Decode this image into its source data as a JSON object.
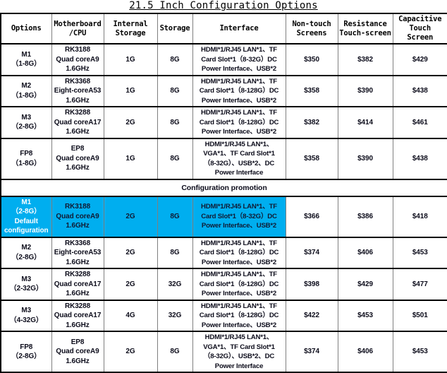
{
  "document": {
    "title": "21.5 Inch Configuration Options"
  },
  "table": {
    "headers": [
      "Options",
      "Motherboard /CPU",
      "Internal Storage",
      "Storage",
      "Interface",
      "Non-touch Screens",
      "Resistance Touch-screen",
      "Capacitive Touch Screen"
    ],
    "headers_lines": {
      "options": "Options",
      "motherboard_l1": "Motherboard",
      "motherboard_l2": "/CPU",
      "internal_l1": "Internal",
      "internal_l2": "Storage",
      "storage": "Storage",
      "interface": "Interface",
      "nontouch_l1": "Non-touch",
      "nontouch_l2": "Screens",
      "resistance_l1": "Resistance",
      "resistance_l2": "Touch-screen",
      "capacitive_l1": "Capacitive",
      "capacitive_l2": "Touch",
      "capacitive_l3": "Screen"
    },
    "promotion_label": "Configuration promotion",
    "colors": {
      "highlight_bg": "#00AEEF",
      "highlight_first_text": "#FFFFFF",
      "highlight_text": "#111A33",
      "border_outer": "#000000",
      "border_inner": "#7F7F7F",
      "page_bg": "#FFFFFF"
    },
    "rows": [
      {
        "option_name": "M1",
        "option_spec": "（1-8G）",
        "option_note": "",
        "cpu_l1": "RK3188",
        "cpu_l2": "Quad coreA9",
        "cpu_l3": "1.6GHz",
        "internal_storage": "1G",
        "storage": "8G",
        "interface_l1": "HDMI*1/RJ45 LAN*1、TF",
        "interface_l2": "Card Slot*1（8-32G）DC",
        "interface_l3": "Power Interface、USB*2",
        "interface_l4": "",
        "non_touch": "$350",
        "resistance": "$382",
        "capacitive": "$429",
        "highlight": false
      },
      {
        "option_name": "M2",
        "option_spec": "（1-8G）",
        "option_note": "",
        "cpu_l1": "RK3368",
        "cpu_l2": "Eight-coreA53",
        "cpu_l3": "1.6GHz",
        "internal_storage": "1G",
        "storage": "8G",
        "interface_l1": "HDMI*1/RJ45 LAN*1、TF",
        "interface_l2": "Card Slot*1（8-128G）DC",
        "interface_l3": "Power Interface、USB*2",
        "interface_l4": "",
        "non_touch": "$358",
        "resistance": "$390",
        "capacitive": "$438",
        "highlight": false
      },
      {
        "option_name": "M3",
        "option_spec": "（2-8G）",
        "option_note": "",
        "cpu_l1": "RK3288",
        "cpu_l2": "Quad coreA17",
        "cpu_l3": "1.6GHz",
        "internal_storage": "2G",
        "storage": "8G",
        "interface_l1": "HDMI*1/RJ45 LAN*1、TF",
        "interface_l2": "Card Slot*1（8-128G）DC",
        "interface_l3": "Power Interface、USB*2",
        "interface_l4": "",
        "non_touch": "$382",
        "resistance": "$414",
        "capacitive": "$461",
        "highlight": false
      },
      {
        "option_name": "FP8",
        "option_spec": "（1-8G）",
        "option_note": "",
        "cpu_l1": "EP8",
        "cpu_l2": "Quad coreA9",
        "cpu_l3": "1.6GHz",
        "internal_storage": "1G",
        "storage": "8G",
        "interface_l1": "HDMI*1/RJ45 LAN*1、",
        "interface_l2": "VGA*1、TF Card Slot*1",
        "interface_l3": "（8-32G）、USB*2、DC",
        "interface_l4": "Power Interface",
        "non_touch": "$358",
        "resistance": "$390",
        "capacitive": "$438",
        "highlight": false
      },
      {
        "option_name": "M1",
        "option_spec": "（2-8G）",
        "option_note": "Default configuration",
        "cpu_l1": "RK3188",
        "cpu_l2": "Quad coreA9",
        "cpu_l3": "1.6GHz",
        "internal_storage": "2G",
        "storage": "8G",
        "interface_l1": "HDMI*1/RJ45 LAN*1、TF",
        "interface_l2": "Card Slot*1（8-32G）DC",
        "interface_l3": "Power Interface、USB*2",
        "interface_l4": "",
        "non_touch": "$366",
        "resistance": "$386",
        "capacitive": "$418",
        "highlight": true
      },
      {
        "option_name": "M2",
        "option_spec": "（2-8G）",
        "option_note": "",
        "cpu_l1": "RK3368",
        "cpu_l2": "Eight-coreA53",
        "cpu_l3": "1.6GHz",
        "internal_storage": "2G",
        "storage": "8G",
        "interface_l1": "HDMI*1/RJ45 LAN*1、TF",
        "interface_l2": "Card Slot*1（8-128G）DC",
        "interface_l3": "Power Interface、USB*2",
        "interface_l4": "",
        "non_touch": "$374",
        "resistance": "$406",
        "capacitive": "$453",
        "highlight": false
      },
      {
        "option_name": "M3",
        "option_spec": "（2-32G）",
        "option_note": "",
        "cpu_l1": "RK3288",
        "cpu_l2": "Quad coreA17",
        "cpu_l3": "1.6GHz",
        "internal_storage": "2G",
        "storage": "32G",
        "interface_l1": "HDMI*1/RJ45 LAN*1、TF",
        "interface_l2": "Card Slot*1（8-128G）DC",
        "interface_l3": "Power Interface、USB*2",
        "interface_l4": "",
        "non_touch": "$398",
        "resistance": "$429",
        "capacitive": "$477",
        "highlight": false
      },
      {
        "option_name": "M3",
        "option_spec": "（4-32G）",
        "option_note": "",
        "cpu_l1": "RK3288",
        "cpu_l2": "Quad coreA17",
        "cpu_l3": "1.6GHz",
        "internal_storage": "4G",
        "storage": "32G",
        "interface_l1": "HDMI*1/RJ45 LAN*1、TF",
        "interface_l2": "Card Slot*1（8-128G）DC",
        "interface_l3": "Power Interface、USB*2",
        "interface_l4": "",
        "non_touch": "$422",
        "resistance": "$453",
        "capacitive": "$501",
        "highlight": false
      },
      {
        "option_name": "FP8",
        "option_spec": "（2-8G）",
        "option_note": "",
        "cpu_l1": "EP8",
        "cpu_l2": "Quad coreA9",
        "cpu_l3": "1.6GHz",
        "internal_storage": "2G",
        "storage": "8G",
        "interface_l1": "HDMI*1/RJ45 LAN*1、",
        "interface_l2": "VGA*1、TF Card Slot*1",
        "interface_l3": "（8-32G）、USB*2、DC",
        "interface_l4": "Power Interface",
        "non_touch": "$374",
        "resistance": "$406",
        "capacitive": "$453",
        "highlight": false
      }
    ],
    "promotion_row_index": 4
  }
}
